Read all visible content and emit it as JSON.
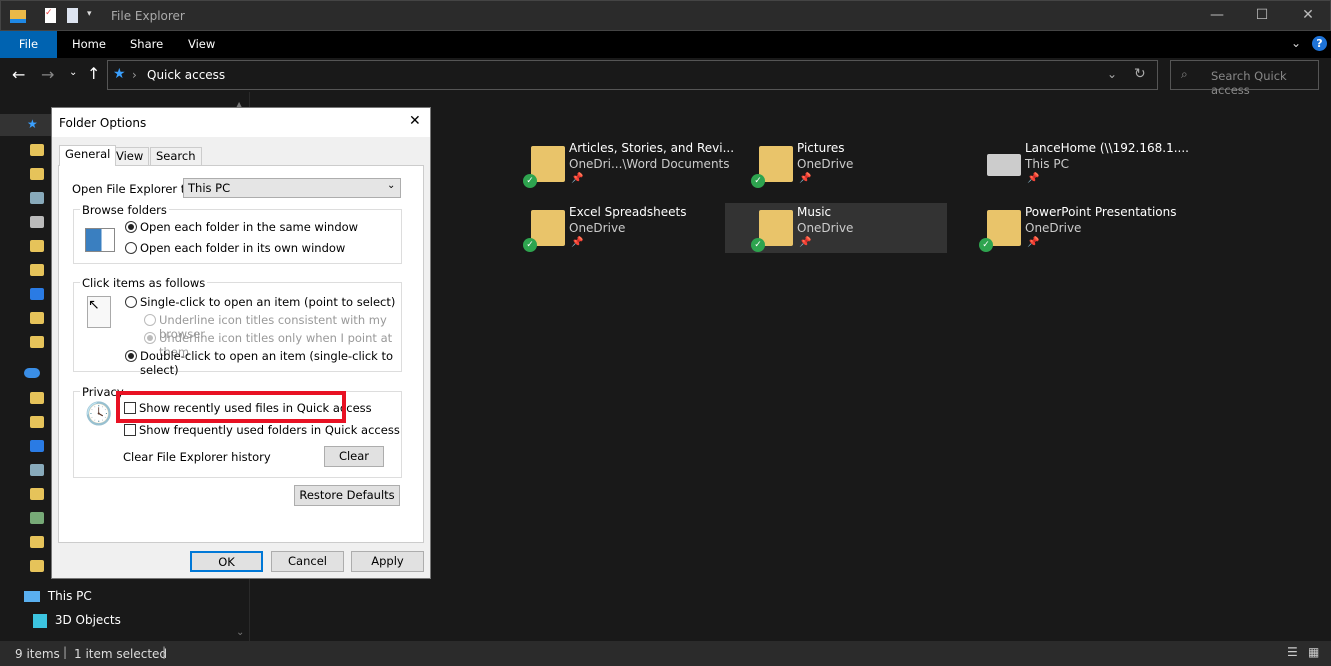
{
  "window": {
    "title": "File Explorer"
  },
  "ribbon": {
    "tabs": [
      "File",
      "Home",
      "Share",
      "View"
    ],
    "accent": "#0063b1"
  },
  "address": {
    "path": "Quick access",
    "search_placeholder": "Search Quick access"
  },
  "nav": {
    "this_pc": "This PC",
    "objects_3d": "3D Objects"
  },
  "items": [
    {
      "name": "Articles, Stories, and Revi...",
      "sub": "OneDri...\\Word Documents"
    },
    {
      "name": "Pictures",
      "sub": "OneDrive"
    },
    {
      "name": "LanceHome (\\\\192.168.1....",
      "sub": "This PC"
    },
    {
      "name": "Excel Spreadsheets",
      "sub": "OneDrive"
    },
    {
      "name": "Music",
      "sub": "OneDrive",
      "selected": true
    },
    {
      "name": "PowerPoint Presentations",
      "sub": "OneDrive"
    }
  ],
  "status": {
    "count": "9 items",
    "selected": "1 item selected"
  },
  "dialog": {
    "title": "Folder Options",
    "tabs": [
      "General",
      "View",
      "Search"
    ],
    "open_to_label": "Open File Explorer to:",
    "open_to_value": "This PC",
    "browse": {
      "label": "Browse folders",
      "same": "Open each folder in the same window",
      "own": "Open each folder in its own window"
    },
    "click": {
      "label": "Click items as follows",
      "single": "Single-click to open an item (point to select)",
      "u1": "Underline icon titles consistent with my browser",
      "u2": "Underline icon titles only when I point at them",
      "double": "Double-click to open an item (single-click to select)"
    },
    "privacy": {
      "label": "Privacy",
      "recent": "Show recently used files in Quick access",
      "frequent": "Show frequently used folders in Quick access",
      "clear_label": "Clear File Explorer history",
      "clear_btn": "Clear",
      "highlight": "#e81123"
    },
    "restore": "Restore Defaults",
    "ok": "OK",
    "cancel": "Cancel",
    "apply": "Apply"
  }
}
